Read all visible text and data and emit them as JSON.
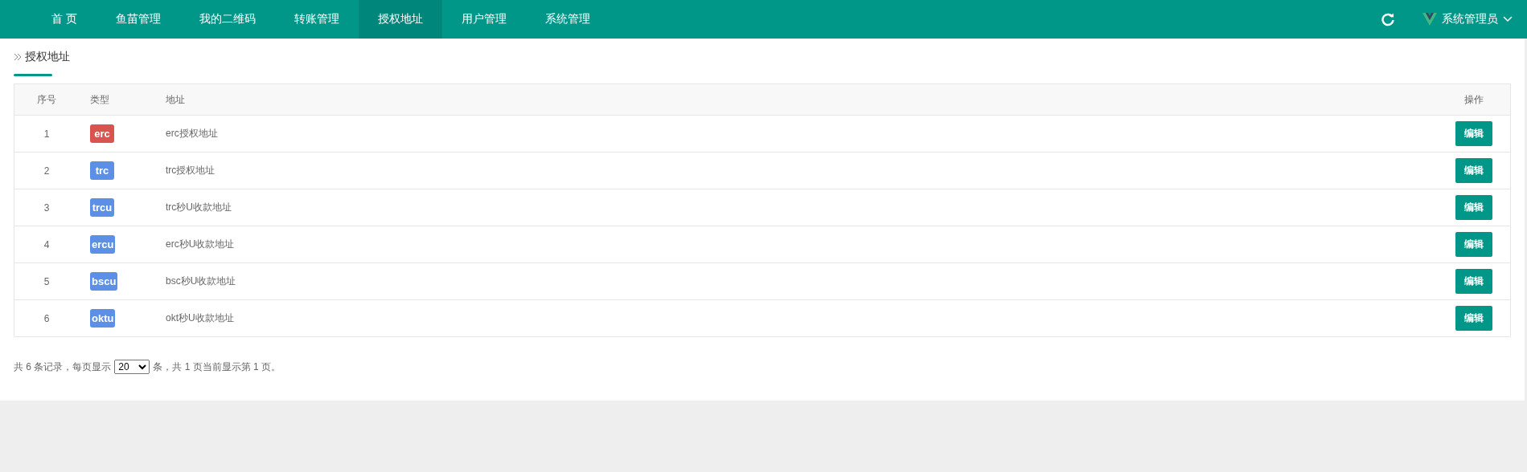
{
  "nav": {
    "items": [
      {
        "label": "首 页",
        "selected": false
      },
      {
        "label": "鱼苗管理",
        "selected": false
      },
      {
        "label": "我的二维码",
        "selected": false
      },
      {
        "label": "转账管理",
        "selected": false
      },
      {
        "label": "授权地址",
        "selected": true
      },
      {
        "label": "用户管理",
        "selected": false
      },
      {
        "label": "系统管理",
        "selected": false
      }
    ],
    "user": "系统管理员"
  },
  "breadcrumb": "授权地址",
  "table": {
    "columns": [
      "序号",
      "类型",
      "地址",
      "操作"
    ],
    "rows": [
      {
        "index": "1",
        "type": "erc",
        "color": "#d9534f",
        "address": "erc授权地址",
        "action": "编辑"
      },
      {
        "index": "2",
        "type": "trc",
        "color": "#5c90e6",
        "address": "trc授权地址",
        "action": "编辑"
      },
      {
        "index": "3",
        "type": "trcu",
        "color": "#5c90e6",
        "address": "trc秒U收款地址",
        "action": "编辑"
      },
      {
        "index": "4",
        "type": "ercu",
        "color": "#5c90e6",
        "address": "erc秒U收款地址",
        "action": "编辑"
      },
      {
        "index": "5",
        "type": "bscu",
        "color": "#5c90e6",
        "address": "bsc秒U收款地址",
        "action": "编辑"
      },
      {
        "index": "6",
        "type": "oktu",
        "color": "#5c90e6",
        "address": "okt秒U收款地址",
        "action": "编辑"
      }
    ]
  },
  "pagination": {
    "before": "共 6 条记录，每页显示",
    "page_size": "20",
    "after": "条，共 1 页当前显示第 1 页。"
  }
}
